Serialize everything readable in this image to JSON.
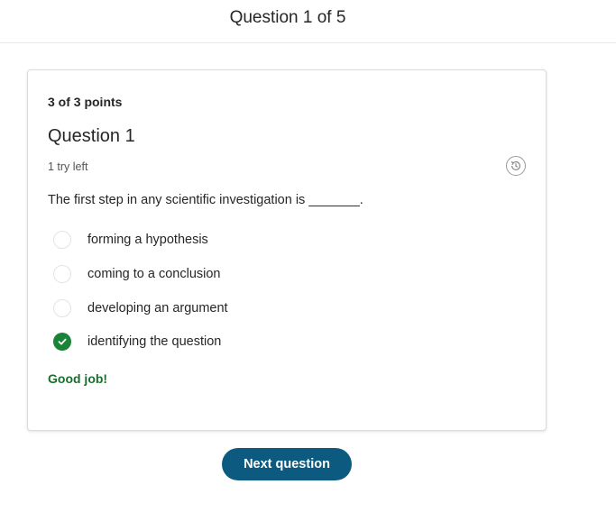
{
  "header": {
    "title": "Question 1 of 5"
  },
  "card": {
    "points": "3 of 3 points",
    "question_title": "Question 1",
    "tries_left": "1 try left",
    "history_icon": "history-icon",
    "prompt": "The first step in any scientific investigation is _______.",
    "options": [
      {
        "label": "forming a hypothesis",
        "selected": false
      },
      {
        "label": "coming to a conclusion",
        "selected": false
      },
      {
        "label": "developing an argument",
        "selected": false
      },
      {
        "label": "identifying the question",
        "selected": true
      }
    ],
    "feedback": "Good job!"
  },
  "footer": {
    "next_label": "Next question"
  },
  "colors": {
    "correct": "#1a8338",
    "feedback": "#1a6e2e",
    "primary_button": "#0c5a7f"
  }
}
